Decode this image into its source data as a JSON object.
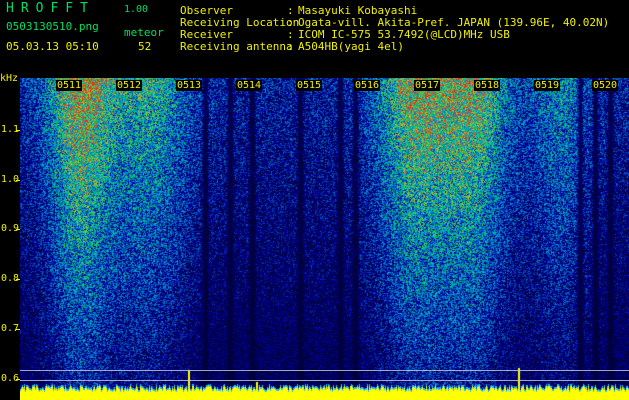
{
  "header": {
    "app_title": "HROFFT",
    "version": "1.00",
    "filename": "0503130510.png",
    "meteor_label": "meteor",
    "datetime": "05.03.13 05:10",
    "meteor_count": "52"
  },
  "info": [
    {
      "label": "Observer",
      "sep": ":",
      "value": "Masayuki Kobayashi"
    },
    {
      "label": "Receiving Location",
      "sep": ":",
      "value": "Ogata-vill. Akita-Pref. JAPAN (139.96E, 40.02N)"
    },
    {
      "label": "Receiver",
      "sep": ":",
      "value": "ICOM IC-575 53.7492(@LCD)MHz USB"
    },
    {
      "label": "Receiving antenna",
      "sep": ":",
      "value": "A504HB(yagi 4el)"
    }
  ],
  "axis": {
    "unit": "kHz",
    "ticks": [
      "1.1",
      "1.0",
      "0.9",
      "0.8",
      "0.7",
      "0.6"
    ]
  },
  "time_labels": [
    "0511",
    "0512",
    "0513",
    "0514",
    "0515",
    "0516",
    "0517",
    "0518",
    "0519",
    "0520"
  ],
  "colors": {
    "text_green": "#00e060",
    "text_yellow": "#f0f000",
    "bottom_band": "#ffff00",
    "bottom_band_base": "#20c0ff"
  }
}
